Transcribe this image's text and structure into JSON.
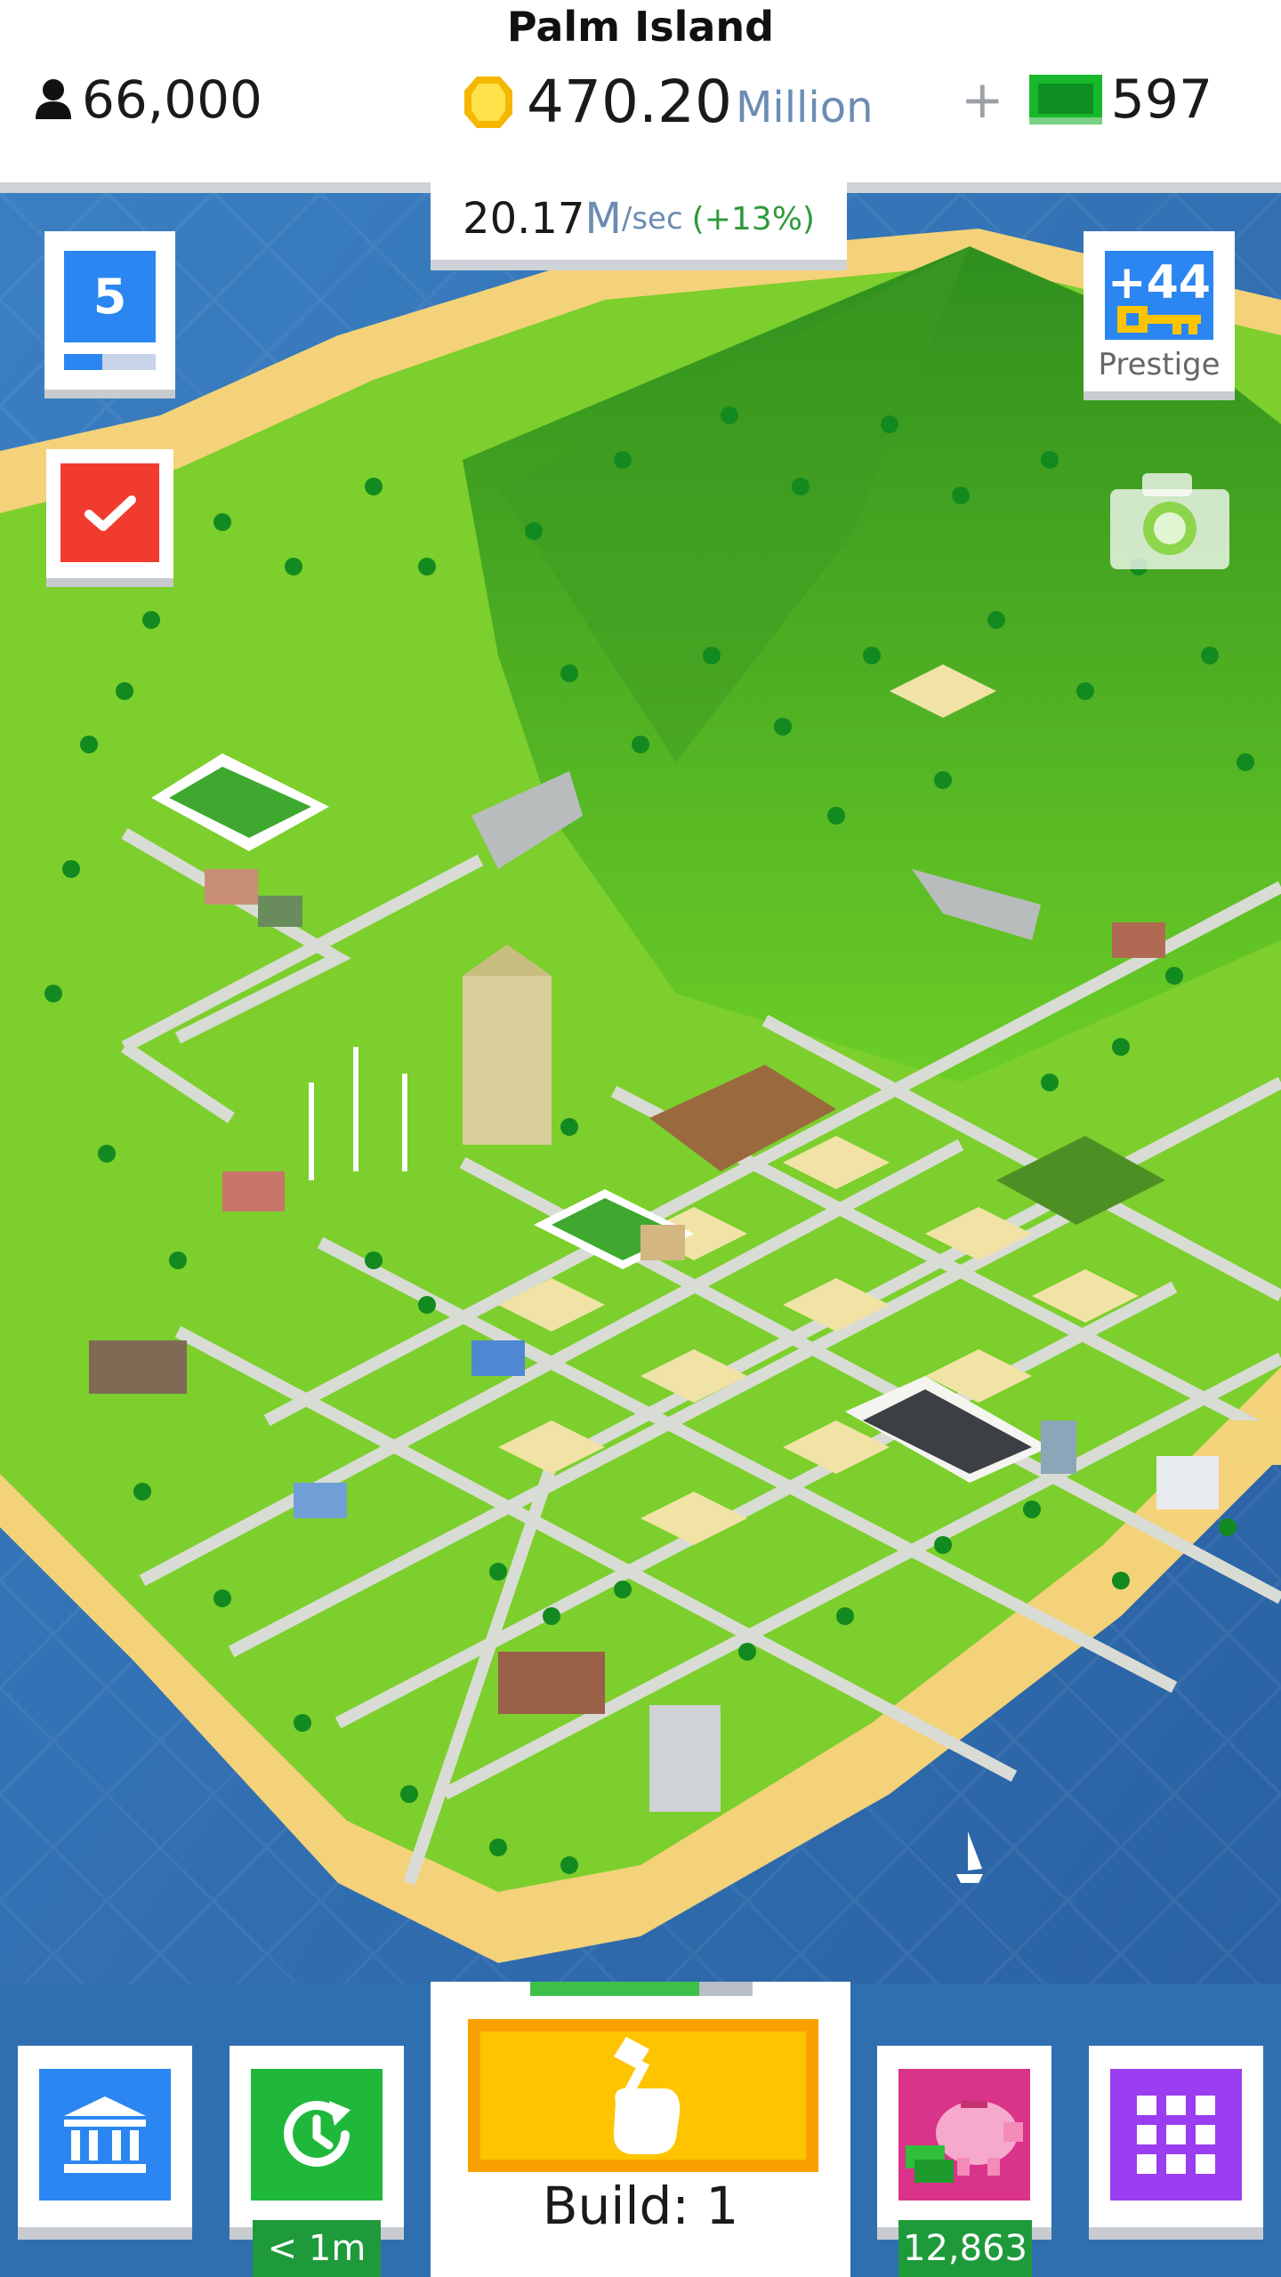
{
  "header": {
    "island_name": "Palm Island",
    "population": "66,000",
    "money_value": "470.20",
    "money_unit": "Million",
    "plus_label": "+",
    "cash_value": "597"
  },
  "rate": {
    "value": "20.17",
    "unit": "M",
    "per": "/sec",
    "bonus": "(+13%)"
  },
  "level": {
    "number": "5",
    "progress": 0.42
  },
  "prestige": {
    "value": "+44",
    "label": "Prestige"
  },
  "bottom": {
    "build_label": "Build: 1",
    "build_progress": 0.76,
    "timer_label": "< 1m",
    "piggy_value": "12,863"
  },
  "icons": {
    "population": "person-icon",
    "money": "coin-icon",
    "cash": "cash-bill-icon",
    "level": "level-badge",
    "tasks": "checkmark-icon",
    "prestige": "key-icon",
    "camera": "camera-icon",
    "bank": "bank-icon",
    "timer": "clock-refresh-icon",
    "build": "hammer-hand-icon",
    "piggy": "piggy-bank-icon",
    "menu": "grid-icon"
  },
  "colors": {
    "accent_blue": "#2b86f2",
    "check_red": "#f23b2f",
    "timer_green": "#1fb83a",
    "build_yellow": "#ffc400",
    "piggy_pink": "#d9338a",
    "grid_purple": "#9b3df0",
    "ocean": "#2f6fb0"
  }
}
